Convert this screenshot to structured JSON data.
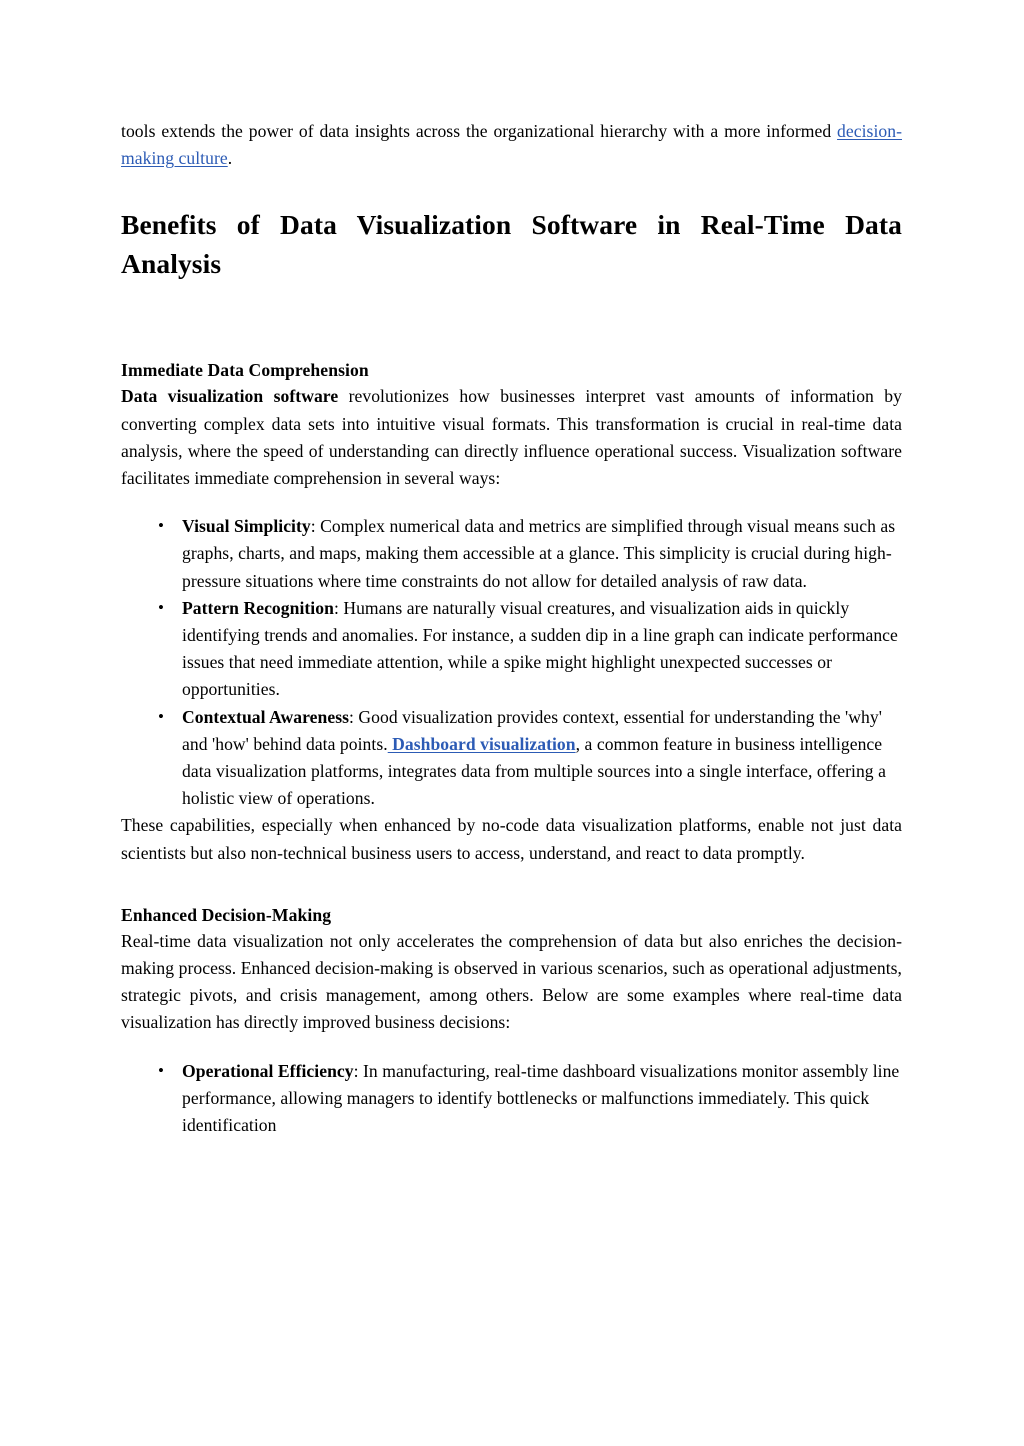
{
  "document": {
    "intro_paragraph": {
      "text_before_link": "tools extends the power of data insights across the organizational hierarchy with a more informed ",
      "link_text": "decision-making culture",
      "text_after_link": "."
    },
    "heading_main": "Benefits of Data Visualization Software in Real-Time Data Analysis",
    "section_one": {
      "subheading": "Immediate Data Comprehension",
      "paragraph": {
        "bold_lead": "Data visualization software",
        "rest": " revolutionizes how businesses interpret vast amounts of information by converting complex data sets into intuitive visual formats. This transformation is crucial in real-time data analysis, where the speed of understanding can directly influence operational success. Visualization software facilitates immediate comprehension in several ways:"
      },
      "bullets": [
        {
          "term": "Visual Simplicity",
          "text": ": Complex numerical data and metrics are simplified through visual means such as graphs, charts, and maps, making them accessible at a glance. This simplicity is crucial during high-pressure situations where time constraints do not allow for detailed analysis of raw data."
        },
        {
          "term": "Pattern Recognition",
          "text": ": Humans are naturally visual creatures, and visualization aids in quickly identifying trends and anomalies. For instance, a sudden dip in a line graph can indicate performance issues that need immediate attention, while a spike might highlight unexpected successes or opportunities."
        },
        {
          "term": "Contextual Awareness",
          "text_before_link": ": Good visualization provides context, essential for understanding the 'why' and 'how' behind data points.",
          "link_text": " Dashboard visualization",
          "text_after_link": ", a common feature in business intelligence data visualization platforms, integrates data from multiple sources into a single interface, offering a holistic view of operations."
        }
      ],
      "closing_paragraph": "These capabilities, especially when enhanced by no-code data visualization platforms, enable not just data scientists but also non-technical business users to access, understand, and react to data promptly."
    },
    "section_two": {
      "subheading": "Enhanced Decision-Making",
      "paragraph": "Real-time data visualization not only accelerates the comprehension of data but also enriches the decision-making process. Enhanced decision-making is observed in various scenarios, such as operational adjustments, strategic pivots, and crisis management, among others. Below are some examples where real-time data visualization has directly improved business decisions:",
      "bullets": [
        {
          "term": "Operational Efficiency",
          "text": ": In manufacturing, real-time dashboard visualizations monitor assembly line performance, allowing managers to identify bottlenecks or malfunctions immediately. This quick identification"
        }
      ]
    },
    "colors": {
      "link": "#2c5bb5",
      "text": "#000000",
      "background": "#ffffff"
    }
  }
}
